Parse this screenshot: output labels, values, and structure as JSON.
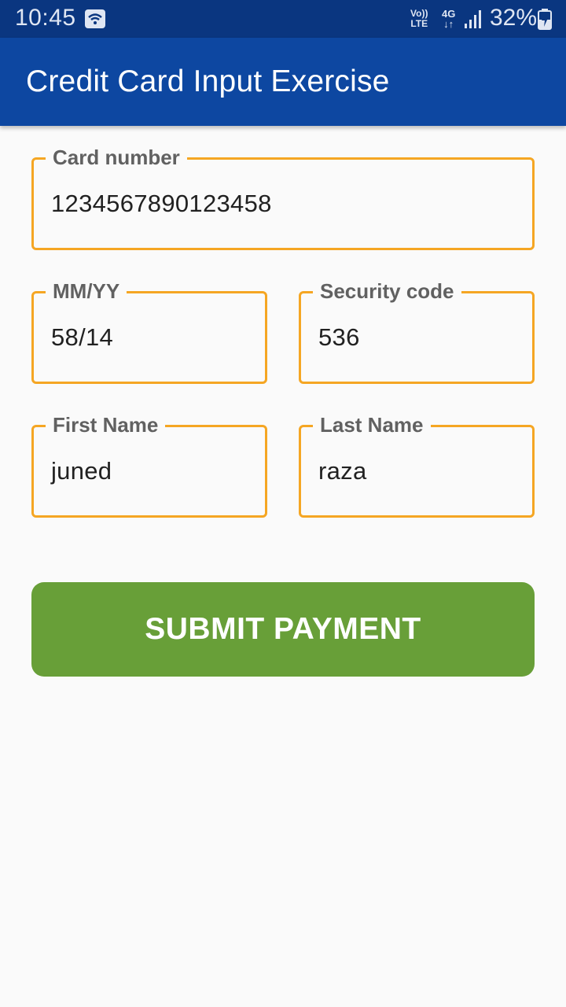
{
  "status_bar": {
    "time": "10:45",
    "volte_top": "Vo))",
    "volte_bottom": "LTE",
    "network_top": "4G",
    "network_bottom": "↓↑",
    "battery": "32%",
    "icons": [
      "wifi-icon",
      "volte-icon",
      "network-4g-icon",
      "signal-icon",
      "battery-charging-icon"
    ]
  },
  "app_bar": {
    "title": "Credit Card Input Exercise",
    "color": "#0d47a1"
  },
  "form": {
    "card_number": {
      "label": "Card number",
      "value": "1234567890123458"
    },
    "expiry": {
      "label": "MM/YY",
      "value": "58/14"
    },
    "security_code": {
      "label": "Security code",
      "value": "536"
    },
    "first_name": {
      "label": "First Name",
      "value": "juned"
    },
    "last_name": {
      "label": "Last Name",
      "value": "raza"
    },
    "border_color": "#f5a623"
  },
  "submit": {
    "label": "SUBMIT PAYMENT",
    "color": "#689f38"
  }
}
